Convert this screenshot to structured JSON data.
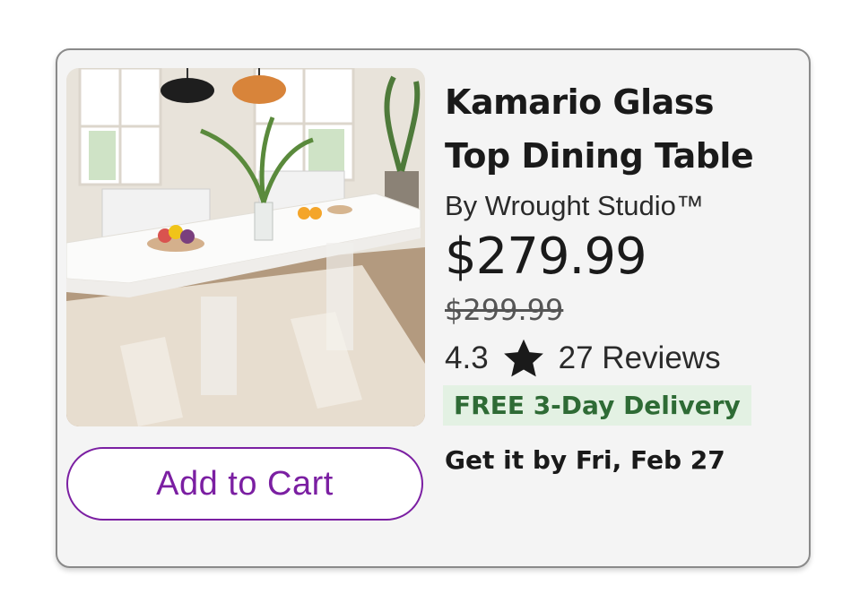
{
  "product": {
    "title_line1": "Kamario Glass",
    "title_line2": "Top Dining Table",
    "brand": "By Wrought Studio™",
    "price": "$279.99",
    "original_price": "$299.99",
    "rating": "4.3",
    "reviews": "27 Reviews",
    "delivery_badge": "FREE 3-Day Delivery",
    "delivery_eta": "Get it by Fri, Feb 27",
    "image_icon": "product-photo",
    "star_icon": "star-icon"
  },
  "actions": {
    "add_to_cart": "Add to Cart"
  },
  "colors": {
    "accent": "#7b1fa2",
    "delivery_bg": "#e3f1e3",
    "delivery_text": "#2e6b35"
  }
}
